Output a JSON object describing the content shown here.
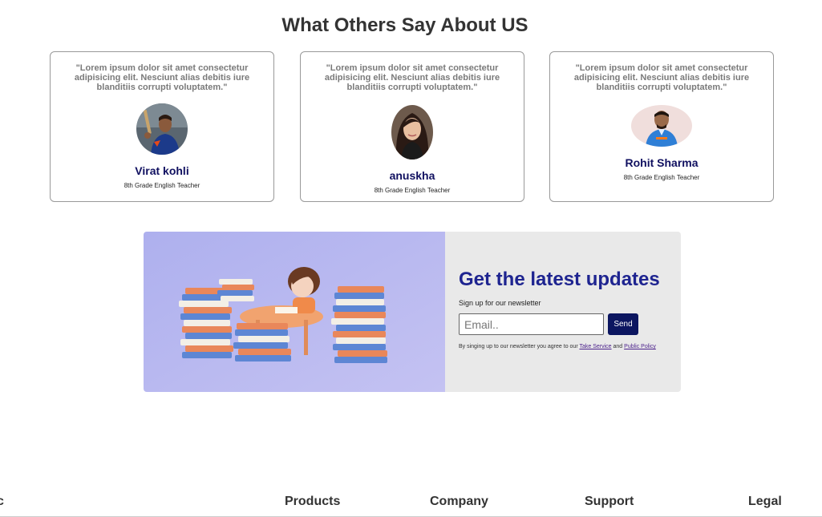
{
  "testimonials": {
    "title": "What Others Say About US",
    "cards": [
      {
        "quote": "\"Lorem ipsum dolor sit amet consectetur adipisicing elit. Nesciunt alias debitis iure blanditiis corrupti voluptatem.\"",
        "name": "Virat kohli",
        "role": "8th Grade English Teacher"
      },
      {
        "quote": "\"Lorem ipsum dolor sit amet consectetur adipisicing elit. Nesciunt alias debitis iure blanditiis corrupti voluptatem.\"",
        "name": "anuskha",
        "role": "8th Grade English Teacher"
      },
      {
        "quote": "\"Lorem ipsum dolor sit amet consectetur adipisicing elit. Nesciunt alias debitis iure blanditiis corrupti voluptatem.\"",
        "name": "Rohit Sharma",
        "role": "8th Grade English Teacher"
      }
    ]
  },
  "newsletter": {
    "title": "Get the latest updates",
    "subtitle": "Sign up for our newsletter",
    "email_placeholder": "Email..",
    "send_label": "Send",
    "terms_prefix": "By singing up to our newsletter you agree to our",
    "terms_link": "Take Service",
    "terms_and": "and",
    "policy_link": "Public Policy",
    "colors": {
      "accent": "#1e2490",
      "button": "#0c1660",
      "panel": "#e9e9e9"
    }
  },
  "footer": {
    "left_fragment": "c",
    "columns": [
      "Products",
      "Company",
      "Support",
      "Legal"
    ]
  }
}
